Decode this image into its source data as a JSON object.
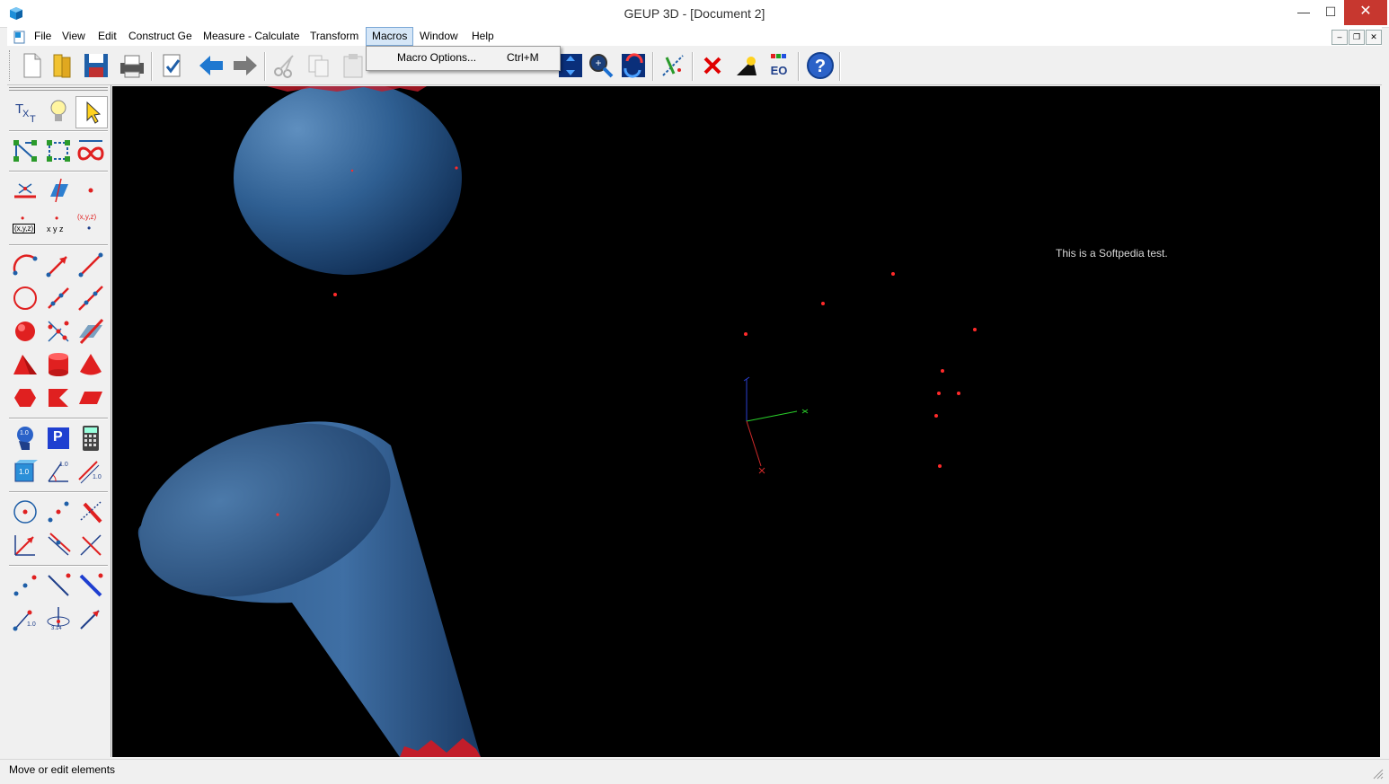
{
  "window": {
    "title": "GEUP 3D - [Document 2]",
    "minimize": "—",
    "maximize": "☐",
    "close": "✕"
  },
  "menubar": {
    "items": [
      "File",
      "View",
      "Edit",
      "Construct Ge",
      "Measure - Calculate",
      "Transform",
      "Macros",
      "Window",
      "Help"
    ],
    "active": "Macros"
  },
  "macros_menu": {
    "item_label": "Macro Options...",
    "item_shortcut": "Ctrl+M"
  },
  "palette": {
    "text_tool": "T",
    "text_tool_sub": "X",
    "text_tool_sub2": "T",
    "coord_label": "(x,y,z)",
    "xyz_label": "x y z",
    "xyz_label2": "(x,y,z)",
    "measure_value": "1.0",
    "param_label": "P",
    "angle_value": "3.14"
  },
  "canvas": {
    "annotation": "This is a Softpedia test.",
    "background": "#000000",
    "object_color": "#2d5a8a",
    "point_color": "#ff2a2a"
  },
  "status": {
    "text": "Move or edit elements"
  }
}
